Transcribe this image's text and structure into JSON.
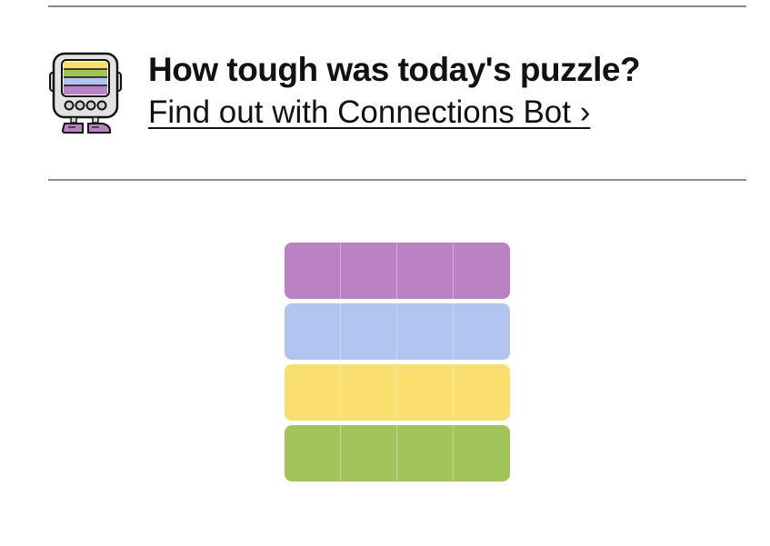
{
  "promo": {
    "headline": "How tough was today's puzzle?",
    "link_text": "Find out with Connections Bot ›",
    "bot_icon": "connections-bot-icon"
  },
  "result_grid": {
    "colors": {
      "purple": "#BA81C5",
      "blue": "#B0C4EF",
      "yellow": "#F9DF6D",
      "green": "#A0C35A"
    },
    "rows": [
      [
        "purple",
        "purple",
        "purple",
        "purple"
      ],
      [
        "blue",
        "blue",
        "blue",
        "blue"
      ],
      [
        "yellow",
        "yellow",
        "yellow",
        "yellow"
      ],
      [
        "green",
        "green",
        "green",
        "green"
      ]
    ]
  }
}
